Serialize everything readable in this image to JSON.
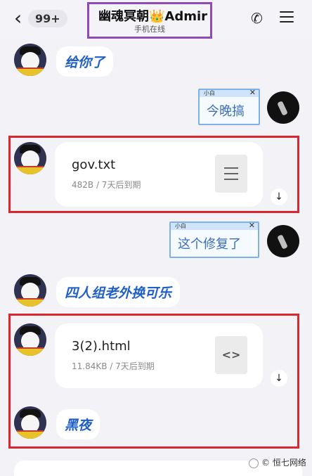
{
  "header": {
    "back_count": "99+",
    "title": "幽魂冥朝👑Admir",
    "subtitle": "手机在线"
  },
  "messages": [
    {
      "type": "text_received",
      "text": "给你了"
    },
    {
      "type": "text_sent",
      "label": "小白",
      "text": "今晚搞"
    },
    {
      "type": "file_received",
      "name": "gov.txt",
      "meta": "482B / 7天后到期",
      "icon": "text-file-icon"
    },
    {
      "type": "text_sent",
      "label": "小白",
      "text": "这个修复了"
    },
    {
      "type": "text_received",
      "text": "四人组老外换可乐"
    },
    {
      "type": "file_received",
      "name": "3(2).html",
      "meta": "11.84KB / 7天后到期",
      "icon": "code-file-icon"
    },
    {
      "type": "text_received",
      "text": "黑夜"
    }
  ],
  "icons": {
    "back": "chevron-left-icon",
    "phone": "phone-icon",
    "menu": "menu-icon",
    "download": "download-icon"
  },
  "watermark": "© 恒七网络",
  "colors": {
    "title_highlight": "#8e4bb6",
    "annotation_red": "#d8272f",
    "received_text": "#1f5fc7"
  }
}
